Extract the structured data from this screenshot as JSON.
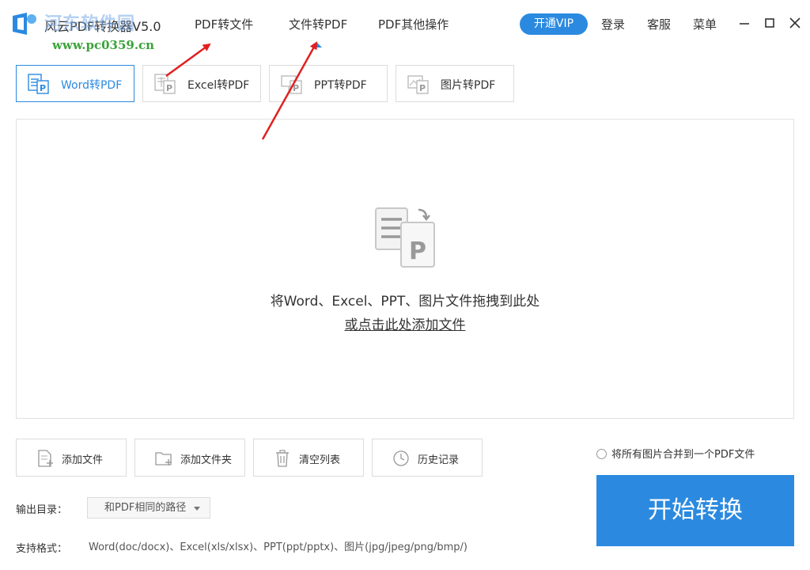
{
  "window": {
    "title": "风云PDF转换器V5.0",
    "watermark_title": "河东软件园",
    "watermark_url": "www.pc0359.cn"
  },
  "nav": {
    "tabs": [
      {
        "label": "PDF转文件"
      },
      {
        "label": "文件转PDF"
      },
      {
        "label": "PDF其他操作"
      }
    ],
    "active_tab": "文件转PDF"
  },
  "top_actions": {
    "vip_label": "开通VIP",
    "login_label": "登录",
    "service_label": "客服",
    "menu_label": "菜单"
  },
  "subtabs": [
    {
      "label": "Word转PDF",
      "icon": "word-doc-icon"
    },
    {
      "label": "Excel转PDF",
      "icon": "excel-doc-icon"
    },
    {
      "label": "PPT转PDF",
      "icon": "ppt-doc-icon"
    },
    {
      "label": "图片转PDF",
      "icon": "image-doc-icon"
    }
  ],
  "dropzone": {
    "hint": "将Word、Excel、PPT、图片文件拖拽到此处",
    "link": "或点击此处添加文件"
  },
  "actions": [
    {
      "label": "添加文件",
      "icon": "add-file-icon"
    },
    {
      "label": "添加文件夹",
      "icon": "add-folder-icon"
    },
    {
      "label": "清空列表",
      "icon": "trash-icon"
    },
    {
      "label": "历史记录",
      "icon": "clock-icon"
    }
  ],
  "merge_option": "将所有图片合并到一个PDF文件",
  "output": {
    "label": "输出目录：",
    "value": "和PDF相同的路径"
  },
  "formats": {
    "label": "支持格式：",
    "value": "Word(doc/docx)、Excel(xls/xlsx)、PPT(ppt/pptx)、图片(jpg/jpeg/png/bmp/)"
  },
  "start_label": "开始转换",
  "colors": {
    "accent": "#2b8ae0",
    "annotation_arrow": "#e02020"
  }
}
